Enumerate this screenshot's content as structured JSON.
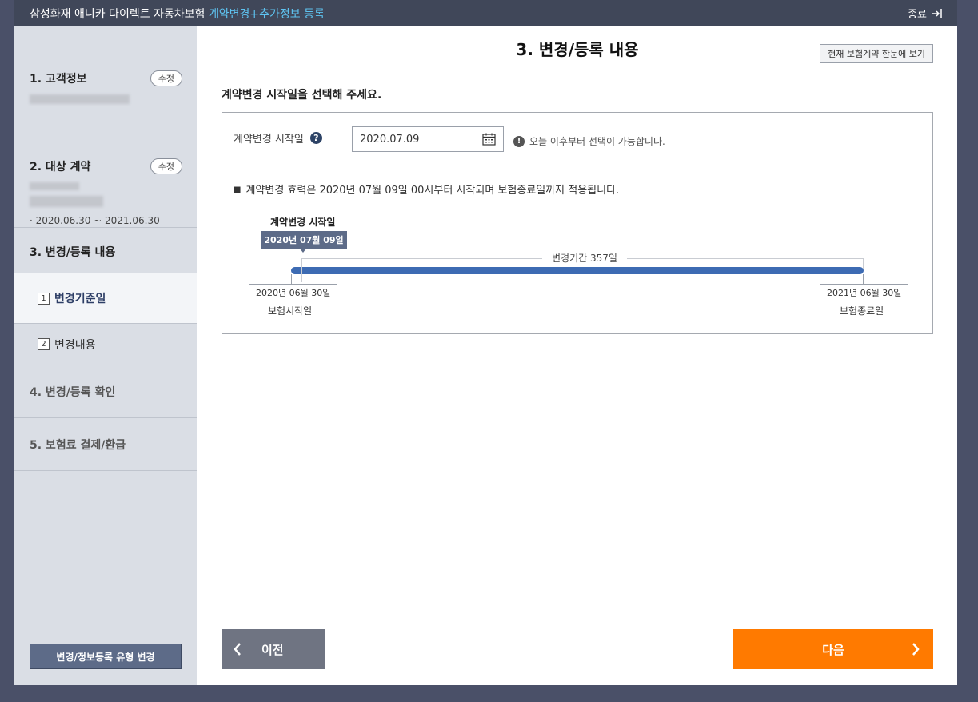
{
  "titlebar": {
    "title": "삼성화재 애니카 다이렉트 자동차보험",
    "highlight": "계약변경+추가정보 등록",
    "close_label": "종료",
    "close_icon": "exit-arrow-icon"
  },
  "sidebar": {
    "customer": {
      "label": "1. 고객정보",
      "edit": "수정"
    },
    "contract": {
      "label": "2. 대상 계약",
      "edit": "수정",
      "period": "· 2020.06.30 ~ 2021.06.30"
    },
    "change": {
      "label": "3. 변경/등록 내용",
      "subitems": [
        {
          "num": "1",
          "label": "변경기준일"
        },
        {
          "num": "2",
          "label": "변경내용"
        }
      ]
    },
    "confirm": {
      "label": "4. 변경/등록 확인"
    },
    "payment": {
      "label": "5. 보험료 결제/환급"
    },
    "type_change_button": "변경/정보등록 유형 변경"
  },
  "main": {
    "page_title": "3. 변경/등록 내용",
    "summary_button": "현재 보험계약 한눈에 보기",
    "instruction": "계약변경 시작일을 선택해 주세요.",
    "field_label": "계약변경 시작일",
    "date_value": "2020.07.09",
    "notice": "오늘 이후부터 선택이 가능합니다.",
    "effect_text": "계약변경 효력은 2020년 07월 09일 00시부터 시작되며 보험종료일까지 적용됩니다.",
    "timeline": {
      "caption": "계약변경 시작일",
      "selected_date": "2020년 07월 09일",
      "period_label": "변경기간 357일",
      "start_date": "2020년 06월 30일",
      "start_label": "보험시작일",
      "end_date": "2021년 06월 30일",
      "end_label": "보험종료일"
    },
    "prev_button": "이전",
    "next_button": "다음"
  },
  "colors": {
    "titlebar_bg": "#404759",
    "highlight": "#5ec3f0",
    "accent_orange": "#ff7a00",
    "timeline_bar": "#3d6bb3",
    "tag_bg": "#5d6b88"
  }
}
